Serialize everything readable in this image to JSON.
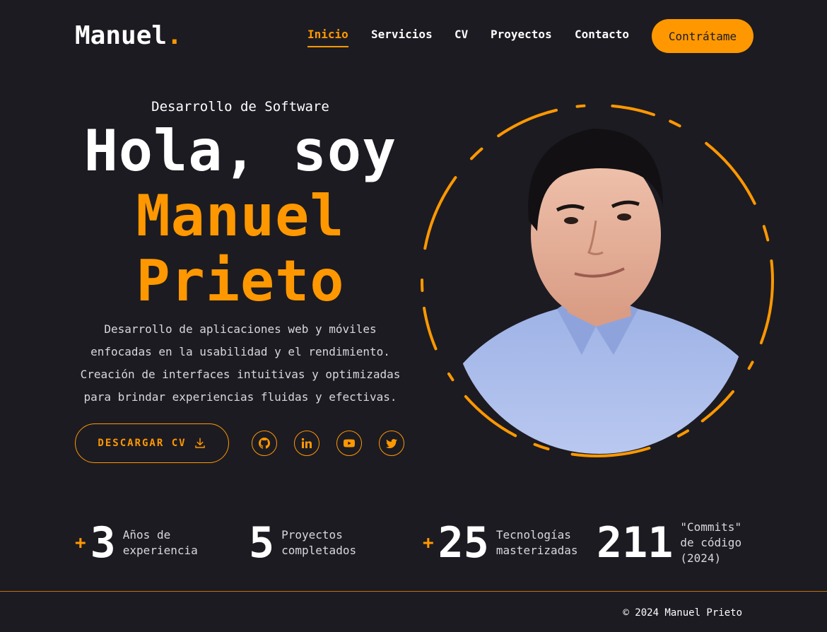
{
  "header": {
    "logo_text": "Manuel",
    "logo_dot": ".",
    "nav": [
      {
        "label": "Inicio",
        "active": true
      },
      {
        "label": "Servicios",
        "active": false
      },
      {
        "label": "CV",
        "active": false
      },
      {
        "label": "Proyectos",
        "active": false
      },
      {
        "label": "Contacto",
        "active": false
      }
    ],
    "cta_label": "Contrátame"
  },
  "hero": {
    "subtitle": "Desarrollo de Software",
    "greeting": "Hola, soy",
    "name_line1": "Manuel",
    "name_line2": "Prieto",
    "description_lines": [
      "Desarrollo de aplicaciones web y móviles",
      "enfocadas en la usabilidad y el rendimiento.",
      "Creación de interfaces intuitivas y optimizadas",
      "para brindar experiencias fluidas y efectivas."
    ],
    "download_cv_label": "DESCARGAR CV",
    "socials": [
      "github-icon",
      "linkedin-icon",
      "youtube-icon",
      "twitter-icon"
    ]
  },
  "stats": [
    {
      "prefix": "+",
      "value": "3",
      "label_lines": [
        "Años de",
        "experiencia"
      ]
    },
    {
      "prefix": "",
      "value": "5",
      "label_lines": [
        "Proyectos",
        "completados"
      ]
    },
    {
      "prefix": "+",
      "value": "25",
      "label_lines": [
        "Tecnologías",
        "masterizadas"
      ]
    },
    {
      "prefix": "",
      "value": "211",
      "label_lines": [
        "\"Commits\"",
        "de código",
        "(2024)"
      ]
    }
  ],
  "footer": {
    "text": "© 2024 Manuel Prieto"
  },
  "colors": {
    "accent": "#ff9800",
    "background": "#1c1b22",
    "text": "#ffffff"
  }
}
